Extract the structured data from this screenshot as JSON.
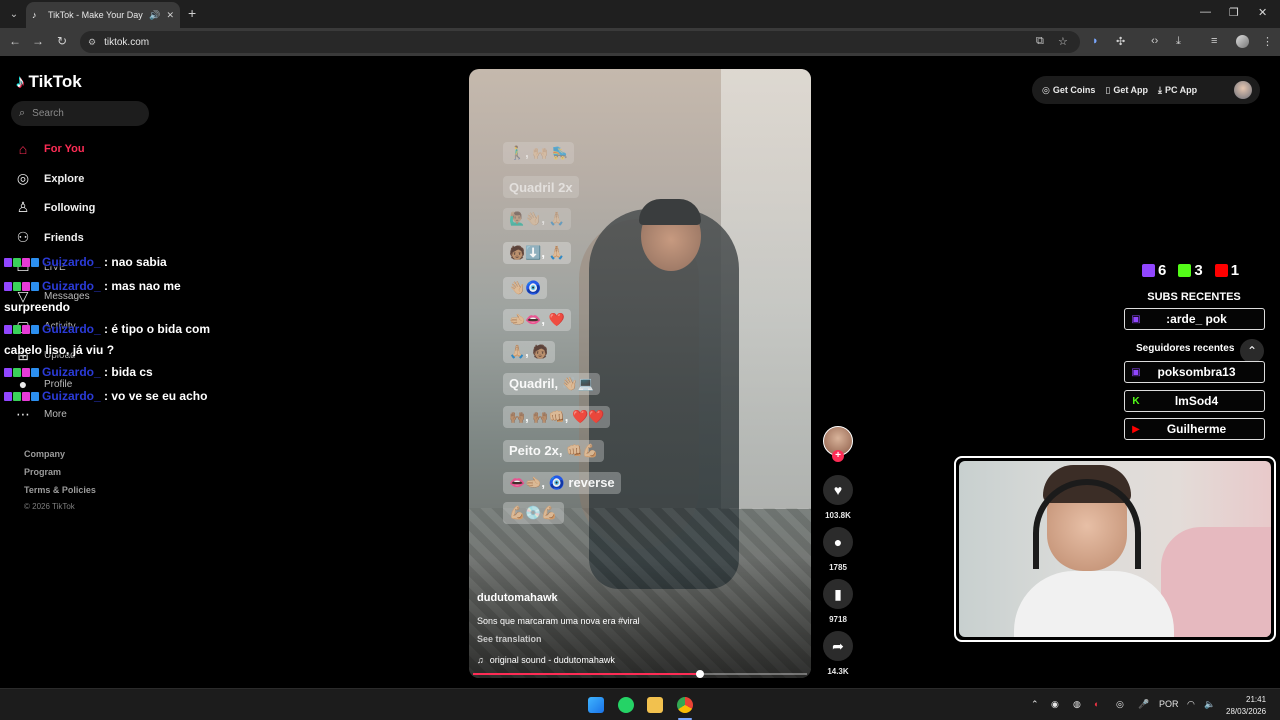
{
  "browser": {
    "tab_title": "TikTok - Make Your Day",
    "url": "tiktok.com",
    "new_tab": "+",
    "tab_list": "⌄",
    "win_min": "—",
    "win_max": "❐",
    "win_close": "✕"
  },
  "tiktok": {
    "logo": "TikTok",
    "search_placeholder": "Search",
    "nav": [
      {
        "label": "For You"
      },
      {
        "label": "Explore"
      },
      {
        "label": "Following"
      },
      {
        "label": "Friends"
      },
      {
        "label": "LIVE"
      },
      {
        "label": "Messages"
      },
      {
        "label": "Activity"
      },
      {
        "label": "Upload"
      },
      {
        "label": "Profile"
      },
      {
        "label": "More"
      }
    ],
    "footer": {
      "company": "Company",
      "program": "Program",
      "terms": "Terms & Policies",
      "copyright": "© 2026 TikTok"
    },
    "top_right": {
      "coins": "Get Coins",
      "app": "Get App",
      "pc_app": "PC App"
    },
    "video": {
      "moves": [
        "🚶‍♂️, 🙌🏼 🛼",
        "Quadril 2x",
        "🙋🏽‍♂️👋🏼, 🙏🏼",
        "🧑🏽⬇️, 🙏🏼",
        "👋🏼🧿",
        "🫲🏼👄, ❤️",
        "🙏🏼, 🧑🏽",
        "Quadril, 👋🏼💻",
        "🙌🏽, 🙌🏽👊🏼, ❤️❤️",
        "Peito 2x, 👊🏼💪🏼",
        "👄🫲🏼, 🧿 reverse",
        "💪🏼💿💪🏼"
      ],
      "author": "dudutomahawk",
      "description": "Sons que marcaram uma nova era #viral",
      "see_translation": "See translation",
      "sound": "original sound - dudutomahawk",
      "progress": 0.68
    },
    "actions": {
      "likes": "103.8K",
      "comments": "1785",
      "saves": "9718",
      "shares": "14.3K"
    }
  },
  "chat": [
    {
      "user": "Guizardo_",
      "text": ": nao sabia"
    },
    {
      "user": "Guizardo_",
      "text": ": mas nao me surpreendo"
    },
    {
      "user": "Guizardo_",
      "text": ": é tipo o bida com cabelo liso, já viu ?"
    },
    {
      "user": "Guizardo_",
      "text": ": bida cs"
    },
    {
      "user": "Guizardo_",
      "text": ": vo ve se eu acho"
    }
  ],
  "overlay": {
    "twitch_count": "6",
    "kick_count": "3",
    "youtube_count": "1",
    "subs_title": "SUBS RECENTES",
    "sub_name": ":arde_    pok",
    "followers_title": "Seguidores recentes",
    "followers": [
      "poksombra13",
      "lmSod4",
      "Guilherme"
    ]
  },
  "taskbar": {
    "lang": "POR",
    "time": "21:41",
    "date": "28/03/2026"
  }
}
